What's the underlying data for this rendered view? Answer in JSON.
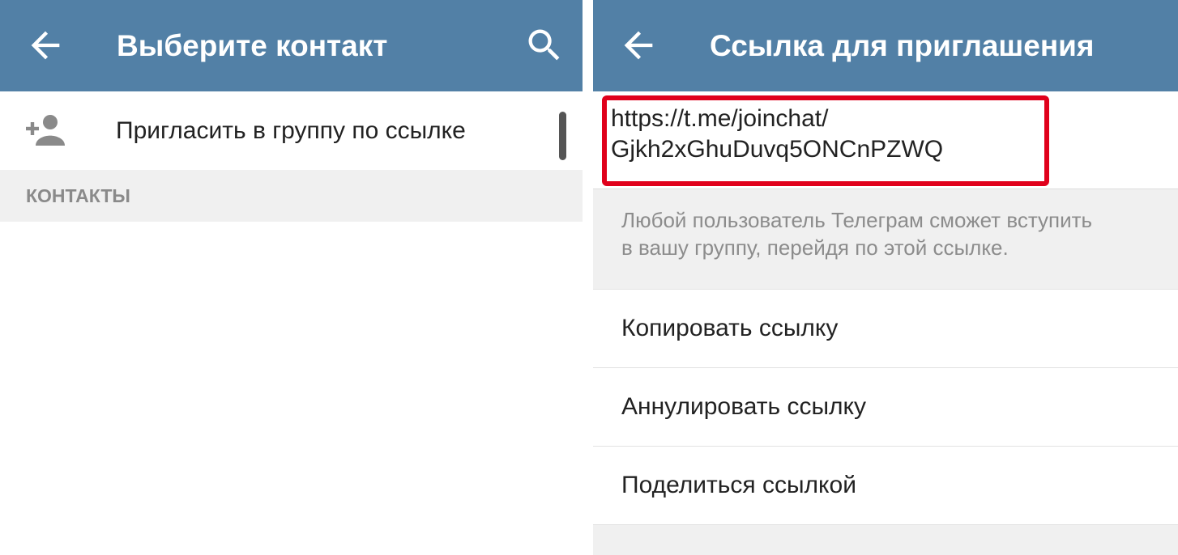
{
  "colors": {
    "appbar": "#5280a6",
    "highlight_border": "#e0001b",
    "section_bg": "#f0f0f0",
    "hint_text": "#8c8c8c"
  },
  "left_screen": {
    "title": "Выберите контакт",
    "back_icon": "arrow-left-icon",
    "search_icon": "search-icon",
    "invite": {
      "icon": "add-person-icon",
      "label": "Пригласить в группу по ссылке"
    },
    "section_header": "КОНТАКТЫ"
  },
  "right_screen": {
    "title": "Ссылка для приглашения",
    "back_icon": "arrow-left-icon",
    "link": {
      "line1": "https://t.me/joinchat/",
      "line2": "Gjkh2xGhuDuvq5ONCnPZWQ"
    },
    "hint_line1": "Любой пользователь Телеграм сможет вступить",
    "hint_line2": "в вашу группу, перейдя по этой ссылке.",
    "actions": [
      {
        "label": "Копировать ссылку"
      },
      {
        "label": "Аннулировать ссылку"
      },
      {
        "label": "Поделиться ссылкой"
      }
    ]
  }
}
